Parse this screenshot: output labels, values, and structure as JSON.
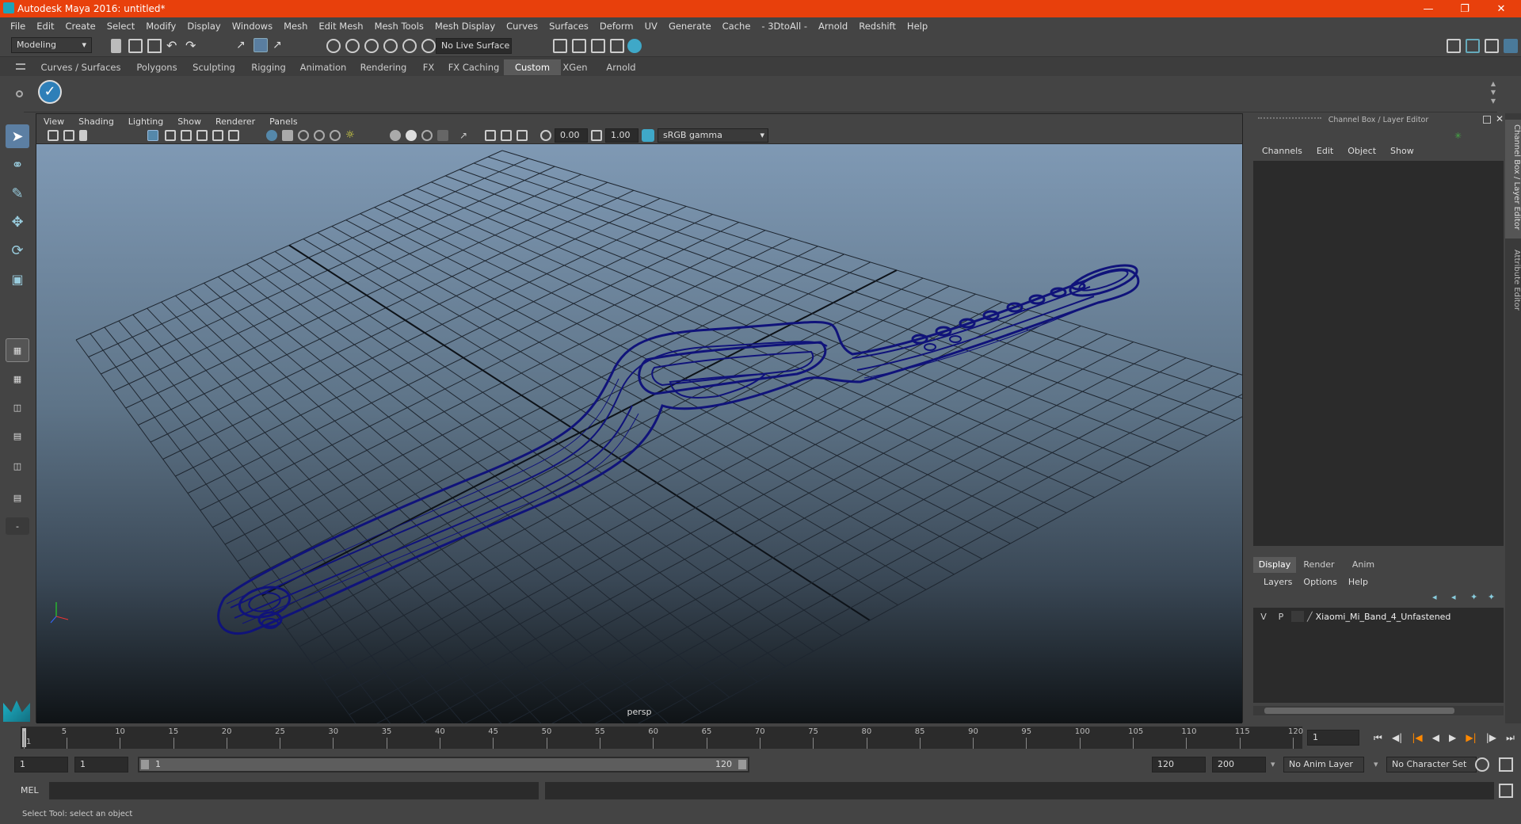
{
  "window": {
    "title": "Autodesk Maya 2016: untitled*"
  },
  "menubar": [
    "File",
    "Edit",
    "Create",
    "Select",
    "Modify",
    "Display",
    "Windows",
    "Mesh",
    "Edit Mesh",
    "Mesh Tools",
    "Mesh Display",
    "Curves",
    "Surfaces",
    "Deform",
    "UV",
    "Generate",
    "Cache",
    "- 3DtoAll -",
    "Arnold",
    "Redshift",
    "Help"
  ],
  "status": {
    "mode": "Modeling",
    "live_surface": "No Live Surface"
  },
  "shelf_tabs": [
    "Curves / Surfaces",
    "Polygons",
    "Sculpting",
    "Rigging",
    "Animation",
    "Rendering",
    "FX",
    "FX Caching",
    "Custom",
    "XGen",
    "Arnold"
  ],
  "shelf_active": "Custom",
  "viewport": {
    "menu": [
      "View",
      "Shading",
      "Lighting",
      "Show",
      "Renderer",
      "Panels"
    ],
    "exposure": "0.00",
    "gamma": "1.00",
    "color_space": "sRGB gamma",
    "camera_label": "persp"
  },
  "channel_box": {
    "title": "Channel Box / Layer Editor",
    "menu": [
      "Channels",
      "Edit",
      "Object",
      "Show"
    ]
  },
  "layer_editor": {
    "tabs": [
      "Display",
      "Render",
      "Anim"
    ],
    "active_tab": "Display",
    "menu": [
      "Layers",
      "Options",
      "Help"
    ],
    "layers": [
      {
        "v": "V",
        "p": "P",
        "name": "Xiaomi_Mi_Band_4_Unfastened"
      }
    ]
  },
  "side_tabs": [
    "Channel Box / Layer Editor",
    "Attribute Editor"
  ],
  "timeline": {
    "ticks": [
      "1",
      "5",
      "10",
      "15",
      "20",
      "25",
      "30",
      "35",
      "40",
      "45",
      "50",
      "55",
      "60",
      "65",
      "70",
      "75",
      "80",
      "85",
      "90",
      "95",
      "100",
      "105",
      "110",
      "115",
      "120"
    ],
    "current_frame": "1"
  },
  "range": {
    "start": "1",
    "playback_start": "1",
    "slider_start": "1",
    "slider_end": "120",
    "playback_end": "120",
    "end": "200",
    "anim_layer": "No Anim Layer",
    "character_set": "No Character Set"
  },
  "command_line": {
    "label": "MEL"
  },
  "help_line": {
    "text": "Select Tool: select an object"
  }
}
